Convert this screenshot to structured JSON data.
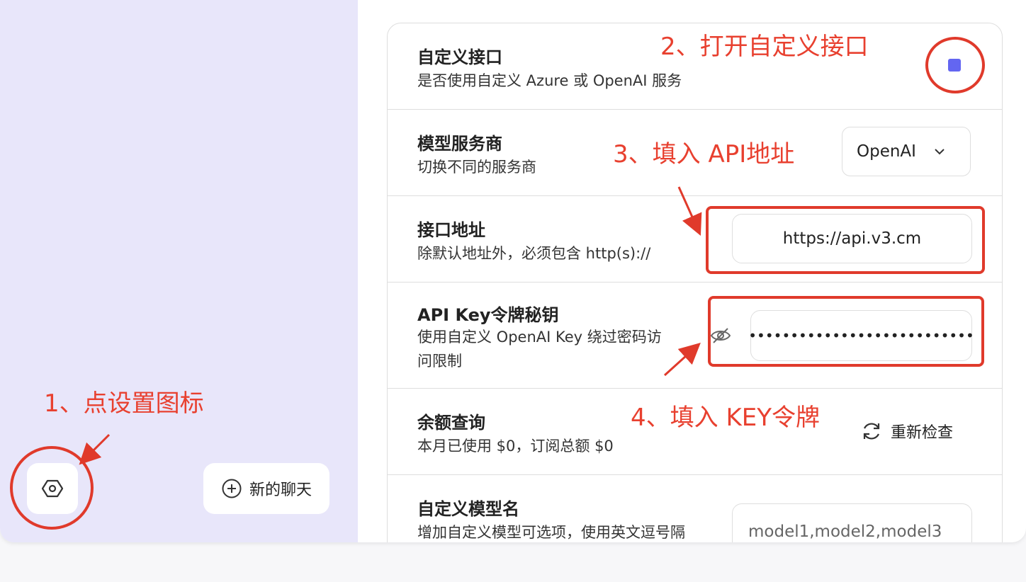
{
  "sidebar": {
    "settings_icon": "settings-hex-icon",
    "new_chat": {
      "icon": "plus-circle-icon",
      "label": "新的聊天"
    }
  },
  "settings": {
    "custom_api": {
      "title": "自定义接口",
      "subtitle": "是否使用自定义 Azure 或 OpenAI 服务",
      "checked": true
    },
    "provider": {
      "title": "模型服务商",
      "subtitle": "切换不同的服务商",
      "selected": "OpenAI"
    },
    "endpoint": {
      "title": "接口地址",
      "subtitle": "除默认地址外，必须包含 http(s)://",
      "value": "https://api.v3.cm"
    },
    "api_key": {
      "title": "API Key令牌秘钥",
      "subtitle_line1": "使用自定义 OpenAI Key 绕过密码访",
      "subtitle_line2": "问限制",
      "value": "•••••••••••••••••••••••••••",
      "visibility_icon": "eye-off-icon"
    },
    "balance": {
      "title": "余额查询",
      "subtitle": "本月已使用 $0，订阅总额 $0",
      "recheck_label": "重新检查"
    },
    "custom_models": {
      "title": "自定义模型名",
      "subtitle": "增加自定义模型可选项，使用英文逗号隔",
      "placeholder": "model1,model2,model3"
    }
  },
  "annotations": {
    "step1": "1、点设置图标",
    "step2": "2、打开自定义接口",
    "step3": "3、填入 API地址",
    "step4": "4、填入 KEY令牌"
  },
  "colors": {
    "sidebar_bg": "#e8e6fa",
    "accent": "#6366f1",
    "annotation_red": "#e03a2b"
  }
}
